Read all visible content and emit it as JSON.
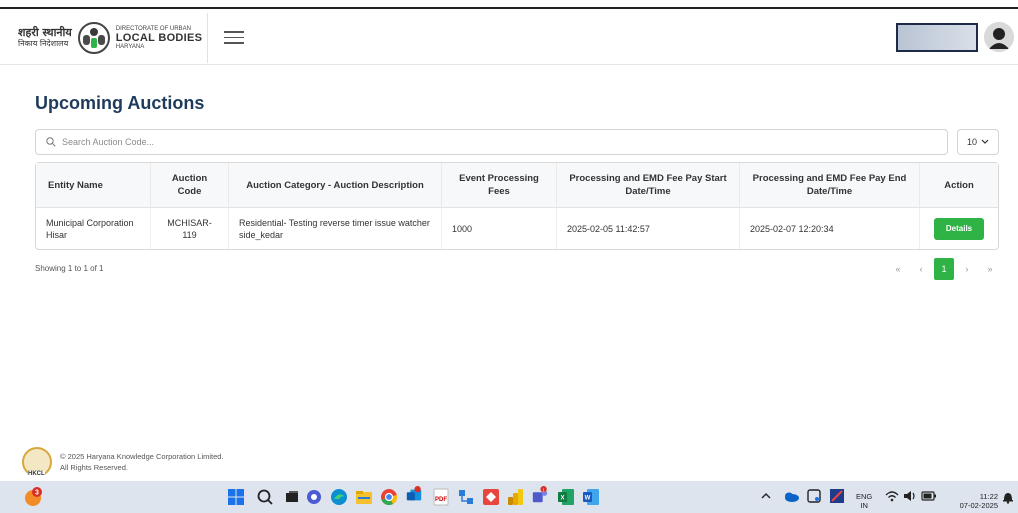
{
  "header": {
    "logo_hindi_line1": "शहरी स्थानीय",
    "logo_hindi_line2": "निकाय निदेशालय",
    "logo_dept_small": "DIRECTORATE OF URBAN",
    "logo_dept_big": "LOCAL BODIES",
    "logo_dept_state": "HARYANA"
  },
  "page": {
    "title": "Upcoming Auctions",
    "search_placeholder": "Search Auction Code...",
    "per_page": "10"
  },
  "table": {
    "headers": [
      "Entity Name",
      "Auction Code",
      "Auction Category - Auction Description",
      "Event Processing Fees",
      "Processing and EMD Fee Pay Start Date/Time",
      "Processing and EMD Fee Pay End Date/Time",
      "Action"
    ],
    "rows": [
      {
        "entity": "Municipal Corporation Hisar",
        "code": "MCHISAR-119",
        "category": "Residential- Testing reverse timer issue watcher side_kedar",
        "fees": "1000",
        "start": "2025-02-05 11:42:57",
        "end": "2025-02-07 12:20:34",
        "action": "Details"
      }
    ],
    "showing": "Showing 1 to 1 of 1",
    "pager": {
      "first": "«",
      "prev": "‹",
      "current": "1",
      "next": "›",
      "last": "»"
    }
  },
  "footer": {
    "copyright": "© 2025 Haryana Knowledge Corporation Limited.",
    "rights": "All Rights Reserved.",
    "logo_text": "HKCL"
  },
  "taskbar": {
    "language": "ENG",
    "region": "IN",
    "time": "11:22",
    "date": "07-02-2025",
    "notification_count": "3",
    "teams_badge": "1"
  },
  "colors": {
    "accent_green": "#2eb344",
    "title_blue": "#1f3b5c"
  }
}
